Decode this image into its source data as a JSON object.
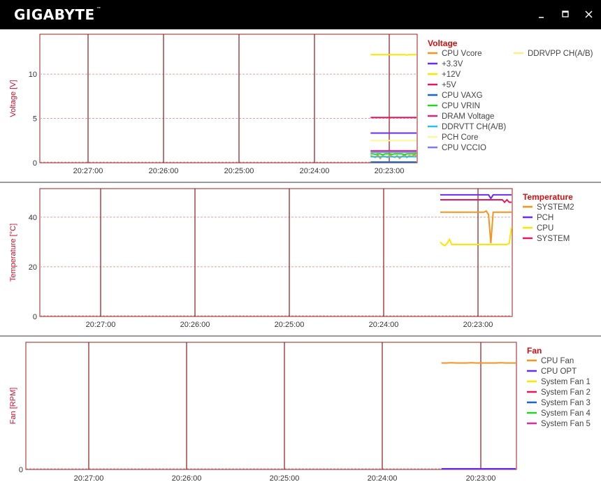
{
  "app": {
    "logo_text": "GIGABYTE",
    "trademark": "™",
    "window_controls": {
      "minimize_icon": "minimize-icon",
      "maximize_icon": "maximize-icon",
      "close_icon": "close-icon"
    }
  },
  "colors": {
    "plot_border": "#9b1c1c",
    "vertical_grid": "#8b1a1a",
    "horizontal_grid": "#e8a0a0",
    "axis_label": "#c8102e",
    "legend_title": "#d01010"
  },
  "time_ticks": [
    "20:27:00",
    "20:26:00",
    "20:25:00",
    "20:24:00",
    "20:23:00"
  ],
  "charts": [
    {
      "id": "voltage",
      "legend_title": "Voltage",
      "ylabel": "Voltage [V]",
      "yticks": [
        0,
        5,
        10
      ],
      "ylim": [
        0,
        14.5
      ],
      "series": [
        {
          "name": "CPU Vcore",
          "color": "#f7941d"
        },
        {
          "name": "+3.3V",
          "color": "#6a2cf5"
        },
        {
          "name": "+12V",
          "color": "#ffe400"
        },
        {
          "name": "+5V",
          "color": "#e8175d"
        },
        {
          "name": "CPU VAXG",
          "color": "#1565e0"
        },
        {
          "name": "CPU VRIN",
          "color": "#22d61e"
        },
        {
          "name": "DRAM Voltage",
          "color": "#d6287a"
        },
        {
          "name": "DDRVTT CH(A/B)",
          "color": "#21c4f0"
        },
        {
          "name": "PCH Core",
          "color": "#fff59a"
        },
        {
          "name": "CPU VCCIO",
          "color": "#7d7df0"
        },
        {
          "name": "DDRVPP CH(A/B)",
          "color": "#ffef80"
        }
      ]
    },
    {
      "id": "temperature",
      "legend_title": "Temperature",
      "ylabel": "Temperature [°C]",
      "yticks": [
        0,
        20,
        40
      ],
      "ylim": [
        0,
        51.5
      ],
      "series": [
        {
          "name": "SYSTEM2",
          "color": "#f7941d"
        },
        {
          "name": "PCH",
          "color": "#6a2cf5"
        },
        {
          "name": "CPU",
          "color": "#ffe400"
        },
        {
          "name": "SYSTEM",
          "color": "#e8175d"
        }
      ]
    },
    {
      "id": "fan",
      "legend_title": "Fan",
      "ylabel": "Fan [RPM]",
      "yticks": [
        0
      ],
      "ylim": [
        0,
        2400
      ],
      "series": [
        {
          "name": "CPU Fan",
          "color": "#f7941d"
        },
        {
          "name": "CPU OPT",
          "color": "#6a2cf5"
        },
        {
          "name": "System Fan 1",
          "color": "#ffe400"
        },
        {
          "name": "System Fan 2",
          "color": "#e8175d"
        },
        {
          "name": "System Fan 3",
          "color": "#1565e0"
        },
        {
          "name": "System Fan 4",
          "color": "#22d61e"
        },
        {
          "name": "System Fan 5",
          "color": "#e8289a"
        }
      ]
    }
  ]
}
